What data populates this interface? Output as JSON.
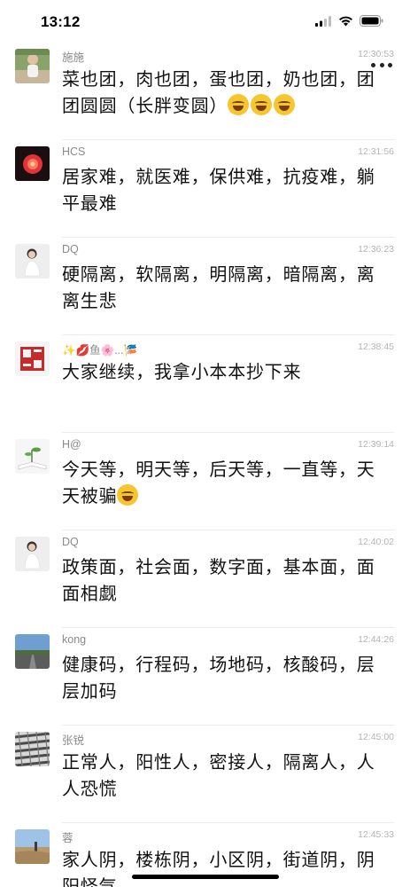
{
  "status_bar": {
    "time": "13:12",
    "icons": [
      "signal-icon",
      "wifi-icon",
      "battery-icon"
    ]
  },
  "header": {
    "more_icon": "more-icon"
  },
  "messages": [
    {
      "sender": "施施",
      "time": "12:30:53",
      "text": "菜也团，肉也团，蛋也团，奶也团，团团圆圆（长胖变圆）",
      "emoji": "😂😂😂",
      "avatar": "avatar-photo-person"
    },
    {
      "sender": "HCS",
      "time": "12:31:56",
      "text": "居家难，就医难，保供难，抗疫难，躺平最难",
      "emoji": "",
      "avatar": "avatar-red-lantern"
    },
    {
      "sender": "DQ",
      "time": "12:36:23",
      "text": "硬隔离，软隔离，明隔离，暗隔离，离离生悲",
      "emoji": "",
      "avatar": "avatar-photo-woman"
    },
    {
      "sender": "✨💋鱼🌸...🎏",
      "time": "12:38:45",
      "text": "大家继续，我拿小本本抄下来",
      "emoji": "",
      "avatar": "avatar-red-seal"
    },
    {
      "sender": "H@",
      "time": "12:39:14",
      "text": "今天等，明天等，后天等，一直等，天天被骗",
      "emoji": "😭",
      "avatar": "avatar-book-plant"
    },
    {
      "sender": "DQ",
      "time": "12:40:02",
      "text": "政策面，社会面，数字面，基本面，面面相觑",
      "emoji": "",
      "avatar": "avatar-photo-woman"
    },
    {
      "sender": "kong",
      "time": "12:44:26",
      "text": "健康码，行程码，场地码，核酸码，层层加码",
      "emoji": "",
      "avatar": "avatar-landscape-road"
    },
    {
      "sender": "张锐",
      "time": "12:45:00",
      "text": "正常人，阳性人，密接人，隔离人，人人恐慌",
      "emoji": "",
      "avatar": "avatar-pattern"
    },
    {
      "sender": "蓉",
      "time": "12:45:33",
      "text": "家人阴，楼栋阴，小区阴，街道阴，阴阳怪气",
      "emoji": "",
      "avatar": "avatar-landscape-field"
    }
  ]
}
